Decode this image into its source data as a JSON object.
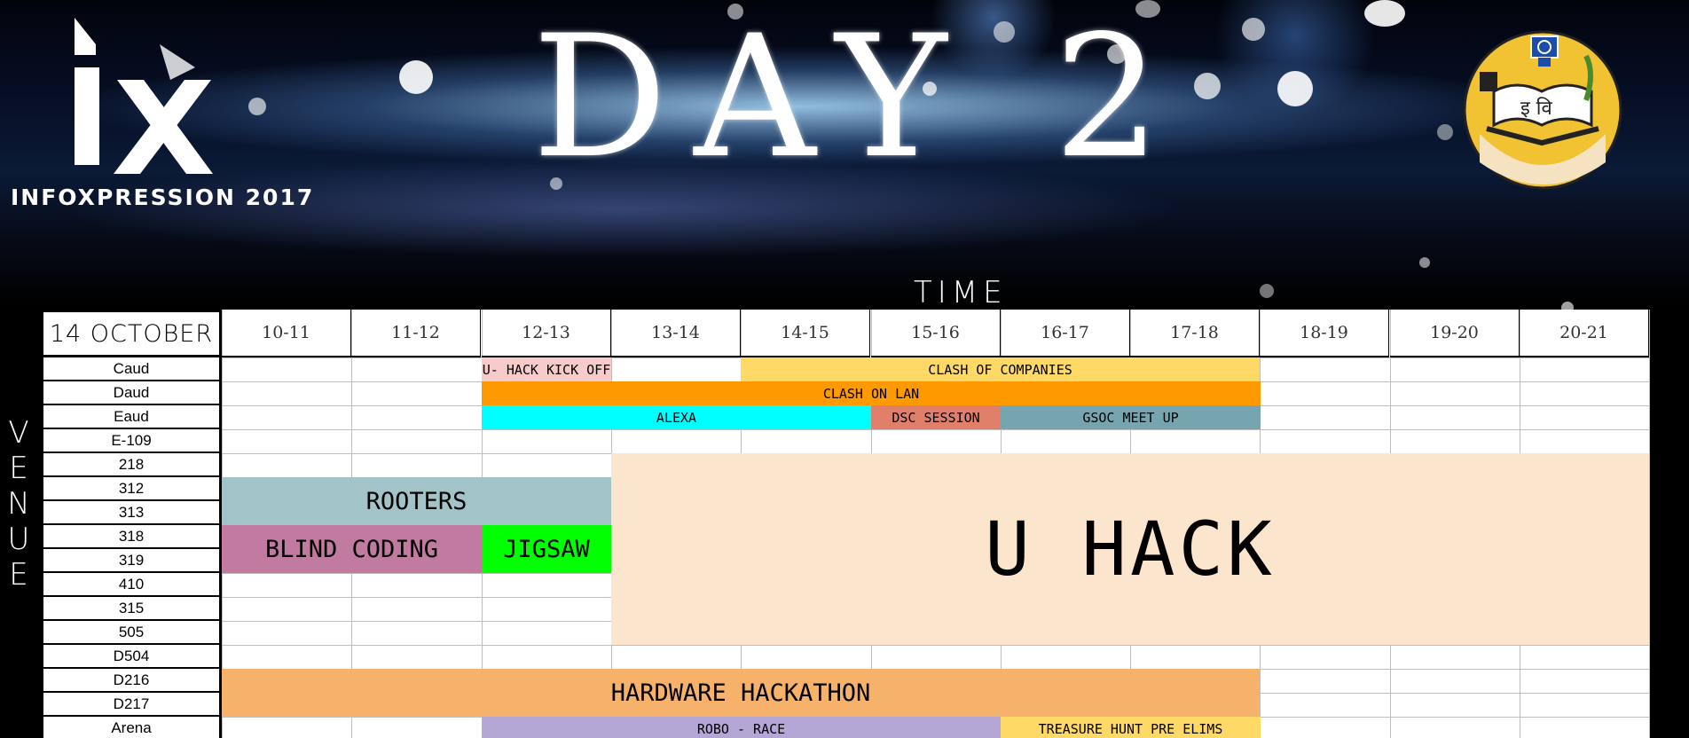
{
  "banner": {
    "title": "DAY 2",
    "brand": "INFOXPRESSION  2017",
    "emblem_text": "इ वि"
  },
  "axis_labels": {
    "time": "TIME",
    "venue": "VENUE"
  },
  "schedule": {
    "date": "14 OCTOBER",
    "time_slots": [
      "10-11",
      "11-12",
      "12-13",
      "13-14",
      "14-15",
      "15-16",
      "16-17",
      "17-18",
      "18-19",
      "19-20",
      "20-21"
    ],
    "venues": [
      "Caud",
      "Daud",
      "Eaud",
      "E-109",
      "218",
      "312",
      "313",
      "318",
      "319",
      "410",
      "315",
      "505",
      "D504",
      "D216",
      "D217",
      "Arena"
    ],
    "events": [
      {
        "name": "U- HACK KICK OFF",
        "color": "#f8cbcb"
      },
      {
        "name": "CLASH OF COMPANIES",
        "color": "#ffd966"
      },
      {
        "name": "CLASH ON LAN",
        "color": "#ff9900"
      },
      {
        "name": "ALEXA",
        "color": "#00ffff"
      },
      {
        "name": "DSC SESSION",
        "color": "#e0806a"
      },
      {
        "name": "GSOC MEET UP",
        "color": "#76a5af"
      },
      {
        "name": "ROOTERS",
        "color": "#a2c4c9"
      },
      {
        "name": "BLIND CODING",
        "color": "#c27ba0"
      },
      {
        "name": "JIGSAW",
        "color": "#00ff00"
      },
      {
        "name": "U HACK",
        "color": "#fce5cd"
      },
      {
        "name": "HARDWARE HACKATHON",
        "color": "#f6b26b"
      },
      {
        "name": "ROBO - RACE",
        "color": "#b4a7d6"
      },
      {
        "name": "TREASURE HUNT PRE ELIMS",
        "color": "#ffd966"
      }
    ]
  }
}
